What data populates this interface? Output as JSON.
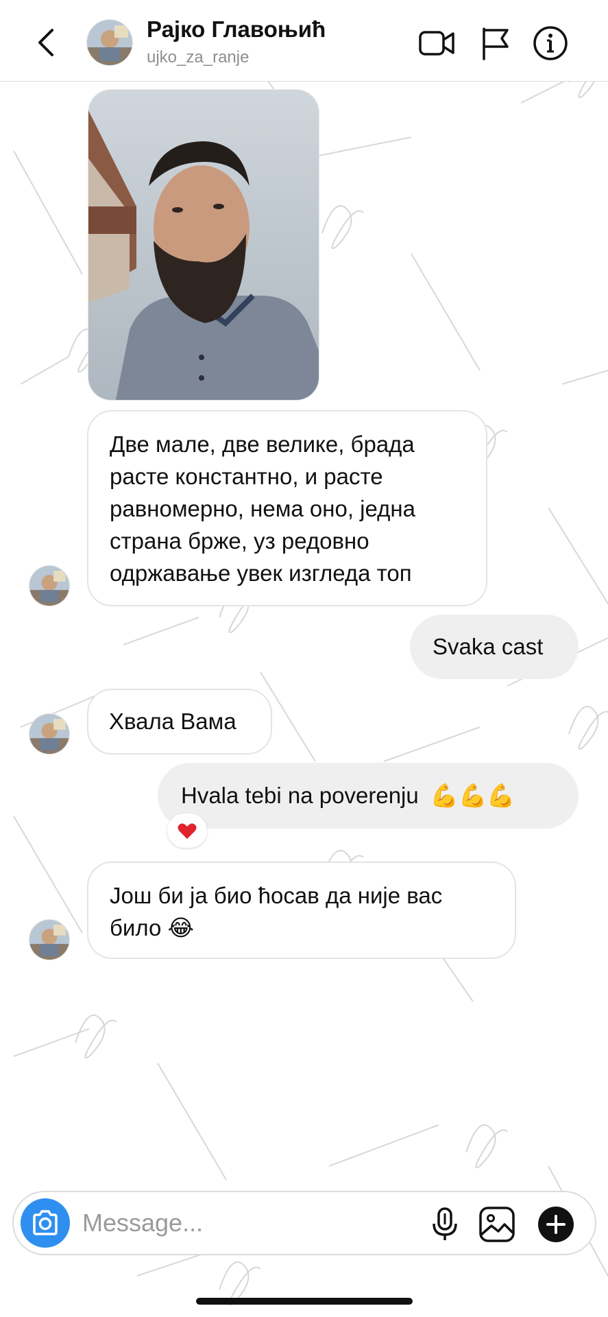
{
  "header": {
    "name": "Рајко Главоњић",
    "username": "ujko_za_ranje"
  },
  "messages": [
    {
      "side": "in",
      "type": "photo"
    },
    {
      "side": "in",
      "text": "Две мале, две велике, брада расте константно, и расте равномерно, нема оно, једна страна брже, уз редовно одржавање увек изгледа топ"
    },
    {
      "side": "out",
      "text": "Svaka cast"
    },
    {
      "side": "in",
      "text": "Хвала Вама"
    },
    {
      "side": "out",
      "text": "Hvala tebi na poverenju",
      "emoji": "💪💪💪",
      "reaction": "heart"
    },
    {
      "side": "in",
      "text": "Још би ја био ћосав да није вас било",
      "emoji": "😂"
    }
  ],
  "composer": {
    "placeholder": "Message..."
  },
  "colors": {
    "accent": "#2f8ff0",
    "out_bubble": "#efefef",
    "in_border": "#e4e4e4",
    "reaction": "#e0242f",
    "secondary_text": "#8e8e8e"
  },
  "icons": [
    "back-chevron-icon",
    "video-icon",
    "flag-icon",
    "info-icon",
    "camera-icon",
    "microphone-icon",
    "gallery-icon",
    "plus-icon",
    "heart-icon",
    "flexed-biceps-emoji",
    "tears-of-joy-emoji"
  ]
}
